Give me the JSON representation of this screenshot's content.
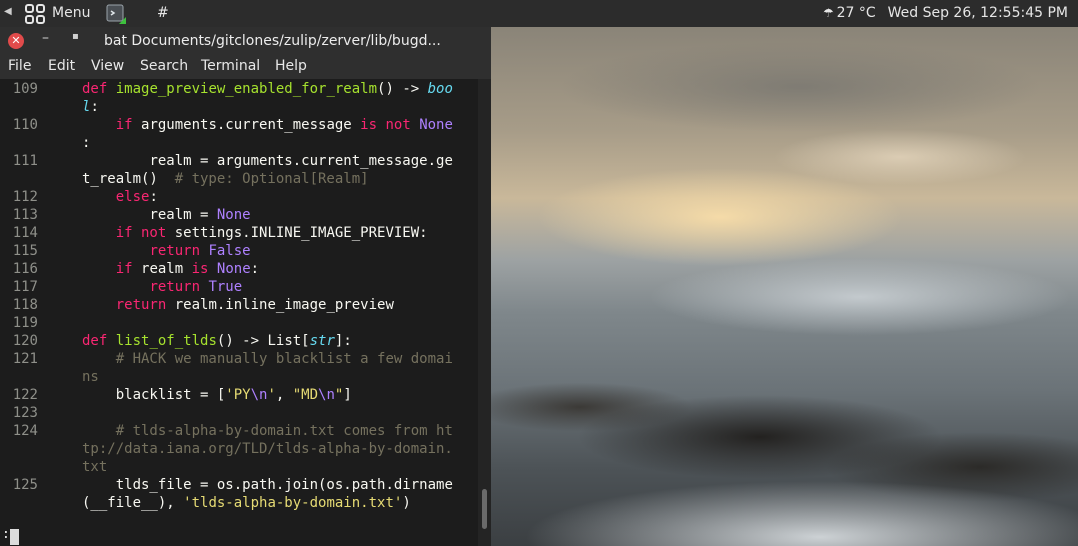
{
  "panel": {
    "menu_label": "Menu",
    "hash": "#",
    "temperature": "27 °C",
    "datetime": "Wed Sep 26, 12:55:45 PM",
    "icons": {
      "menu": "grid-menu-icon",
      "launcher": "terminal-launcher-icon",
      "weather": "weather-cloudy-icon",
      "left": "panel-left-arrow-icon"
    }
  },
  "window": {
    "title": "bat Documents/gitclones/zulip/zerver/lib/bugd...",
    "close_glyph": "✕",
    "minimize_glyph": "–",
    "maximize_glyph": "▪"
  },
  "menubar": [
    "File",
    "Edit",
    "View",
    "Search",
    "Terminal",
    "Help"
  ],
  "code": {
    "line_numbers": [
      "109",
      "110",
      "111",
      "112",
      "113",
      "114",
      "115",
      "116",
      "117",
      "118",
      "119",
      "120",
      "121",
      "122",
      "123",
      "124",
      "125"
    ],
    "lines": {
      "l109a_kw": "def",
      "l109a_fn": "image_preview_enabled_for_realm",
      "l109a_rest": "() -> ",
      "l109a_type": "boo",
      "l109b_type": "l",
      "l109b_rest": ":",
      "l110a_kw": "if",
      "l110a_mid": "arguments.current_message",
      "l110a_kw2": "is not",
      "l110a_none": "None",
      "l110b": ":",
      "l111a": "realm = arguments.current_message.ge",
      "l111b": "t_realm()",
      "l111b_cm": "# type: Optional[Realm]",
      "l112_kw": "else",
      "l112_rest": ":",
      "l113": "realm = ",
      "l113_none": "None",
      "l114_kw": "if not",
      "l114_rest": "settings.INLINE_IMAGE_PREVIEW:",
      "l115_kw": "return",
      "l115_val": "False",
      "l116_kw": "if",
      "l116_mid": "realm",
      "l116_kw2": "is",
      "l116_none": "None",
      "l116_rest": ":",
      "l117_kw": "return",
      "l117_val": "True",
      "l118_kw": "return",
      "l118_rest": "realm.inline_image_preview",
      "l120_kw": "def",
      "l120_fn": "list_of_tlds",
      "l120_rest": "() -> List[",
      "l120_type": "str",
      "l120_end": "]:",
      "l121a": "# HACK we manually blacklist a few domai",
      "l121b": "ns",
      "l122_pre": "blacklist = [",
      "l122_s1": "'PY",
      "l122_e1": "\\n",
      "l122_s1b": "'",
      "l122_comma": ", ",
      "l122_s2": "\"MD",
      "l122_e2": "\\n",
      "l122_s2b": "\"",
      "l122_end": "]",
      "l124a": "# tlds-alpha-by-domain.txt comes from ht",
      "l124b": "tp://data.iana.org/TLD/tlds-alpha-by-domain.",
      "l124c": "txt",
      "l125a": "tlds_file = os.path.join(os.path.dirname",
      "l125b_pre": "(__file__), ",
      "l125b_str": "'tlds-alpha-by-domain.txt'",
      "l125b_end": ")"
    }
  },
  "status": {
    "prompt": ":"
  },
  "colors": {
    "keyword": "#f92672",
    "function": "#a6e22e",
    "builtin": "#66d9ef",
    "constant": "#ae81ff",
    "string": "#e6db74",
    "comment": "#75715e",
    "close_button": "#e14b4b"
  }
}
